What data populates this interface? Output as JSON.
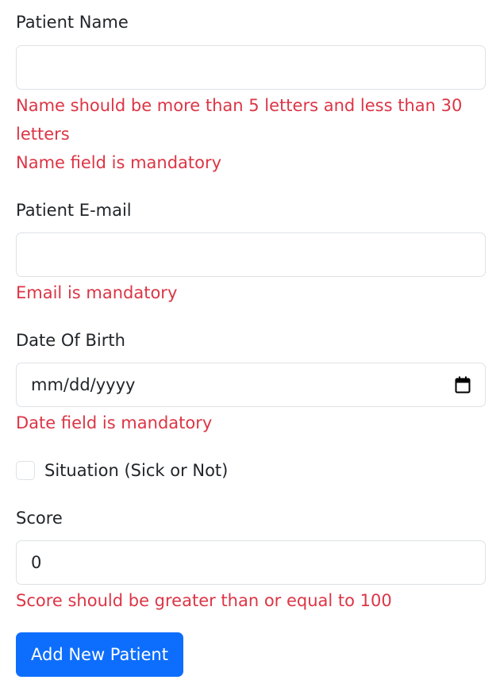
{
  "form": {
    "name": {
      "label": "Patient Name",
      "value": "",
      "errors": [
        "Name should be more than 5 letters and less than 30 letters",
        "Name field is mandatory"
      ]
    },
    "email": {
      "label": "Patient E-mail",
      "value": "",
      "error": "Email is mandatory"
    },
    "dob": {
      "label": "Date Of Birth",
      "placeholder": "mm/dd/yyyy",
      "icon": "calendar-icon",
      "error": "Date field is mandatory"
    },
    "situation": {
      "label": "Situation (Sick or Not)",
      "checked": false
    },
    "score": {
      "label": "Score",
      "value": "0",
      "error": "Score should be greater than or equal to 100"
    },
    "submit_label": "Add New Patient"
  },
  "colors": {
    "error": "#dc3545",
    "primary": "#0d6efd",
    "border": "#dee2e6",
    "text": "#212529"
  }
}
